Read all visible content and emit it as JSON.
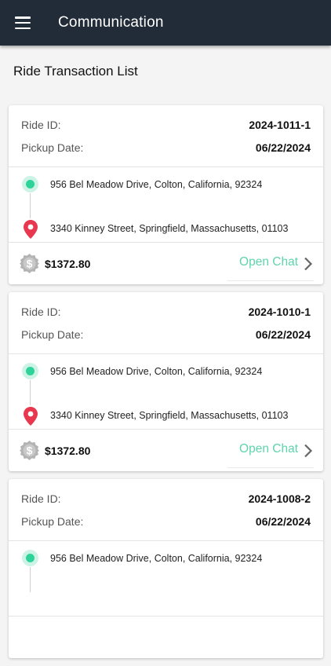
{
  "header": {
    "title": "Communication",
    "menu_icon": "hamburger-menu-icon"
  },
  "page": {
    "section_title": "Ride Transaction List"
  },
  "labels": {
    "ride_id": "Ride ID:",
    "pickup_date": "Pickup Date:",
    "open_chat": "Open Chat"
  },
  "colors": {
    "appbar": "#222b38",
    "accent": "#5fd3ad",
    "pickup": "#2ed39a",
    "dropoff": "#e8384f"
  },
  "rides": [
    {
      "ride_id": "2024-1011-1",
      "pickup_date": "06/22/2024",
      "from": "956 Bel Meadow Drive, Colton, California, 92324",
      "to": "3340 Kinney Street, Springfield, Massachusetts, 01103",
      "amount": "$1372.80"
    },
    {
      "ride_id": "2024-1010-1",
      "pickup_date": "06/22/2024",
      "from": "956 Bel Meadow Drive, Colton, California, 92324",
      "to": "3340 Kinney Street, Springfield, Massachusetts, 01103",
      "amount": "$1372.80"
    },
    {
      "ride_id": "2024-1008-2",
      "pickup_date": "06/22/2024",
      "from": "956 Bel Meadow Drive, Colton, California, 92324"
    }
  ]
}
